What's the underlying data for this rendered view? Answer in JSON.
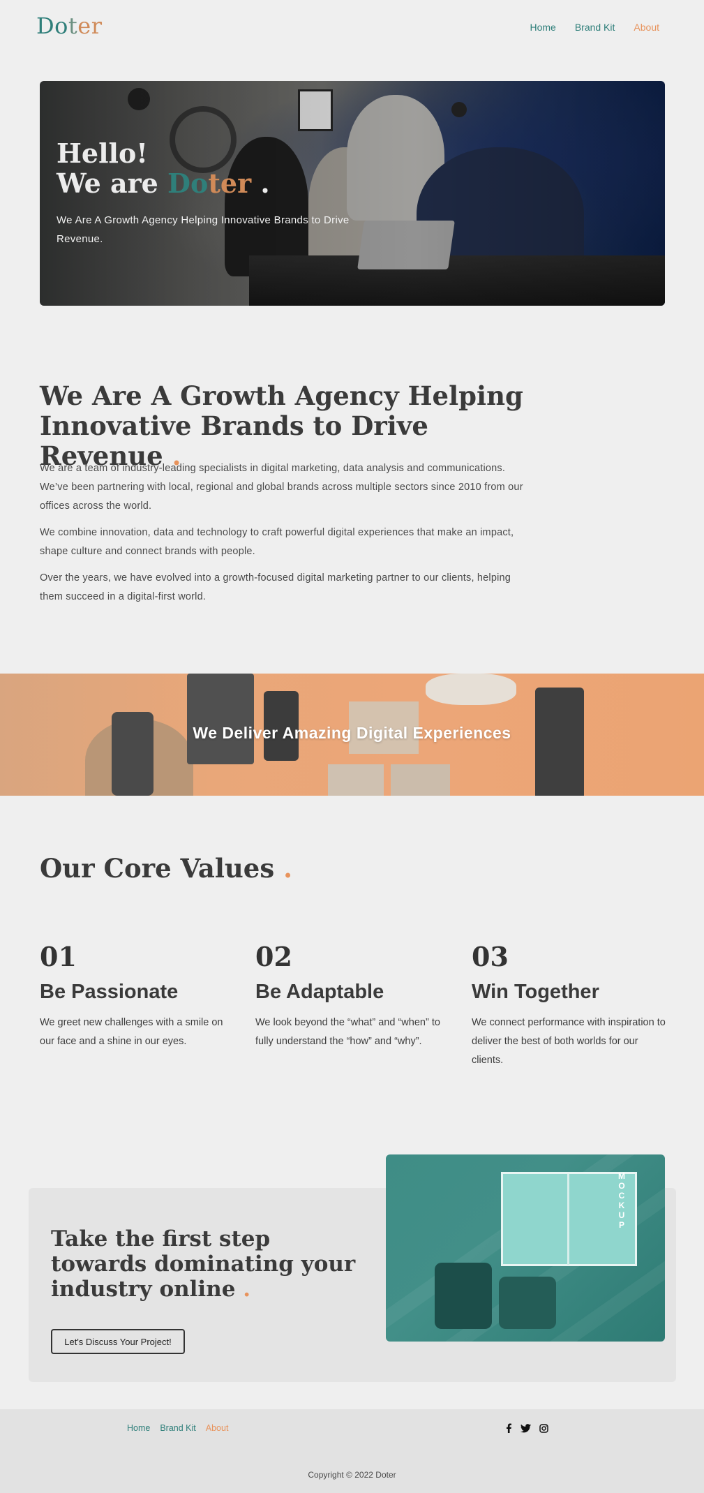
{
  "header": {
    "logo_part1": "Do",
    "logo_part2": "t",
    "logo_part3": "er",
    "nav": [
      {
        "label": "Home"
      },
      {
        "label": "Brand Kit"
      },
      {
        "label": "About"
      }
    ]
  },
  "hero": {
    "line1": "Hello!",
    "line2_prefix": "We are",
    "brand_part1": "Do",
    "brand_part2": "ter",
    "line2_suffix": ".",
    "subtitle": "We Are A Growth Agency Helping Innovative Brands to Drive Revenue."
  },
  "about": {
    "title": "We Are A Growth Agency Helping Innovative Brands to Drive Revenue",
    "title_dot": ".",
    "paragraphs": [
      "We are a team of industry-leading specialists in digital marketing, data analysis and communications. We’ve been partnering with local, regional and global brands across multiple sectors since 2010 from our offices across the world.",
      "We combine innovation, data and technology to craft powerful digital experiences that make an impact, shape culture and connect brands with people.",
      "Over the years, we have evolved into a growth-focused digital marketing partner to our clients, helping them succeed in a digital-first world."
    ]
  },
  "banner": {
    "text": "We Deliver Amazing Digital Experiences"
  },
  "values": {
    "title": "Our Core Values",
    "title_dot": ".",
    "items": [
      {
        "num": "01",
        "name": "Be Passionate",
        "desc": "We greet new challenges with a smile on our face and a shine in our eyes."
      },
      {
        "num": "02",
        "name": "Be Adaptable",
        "desc": "We look beyond the “what” and “when” to fully understand the “how” and “why”."
      },
      {
        "num": "03",
        "name": "Win Together",
        "desc": "We connect performance with inspiration to deliver the best of both worlds for our clients."
      }
    ]
  },
  "cta": {
    "title": "Take the first step towards dominating your industry online",
    "title_dot": ".",
    "button": "Let's Discuss Your Project!",
    "image_text": "MOCKUP"
  },
  "footer": {
    "nav": [
      {
        "label": "Home"
      },
      {
        "label": "Brand Kit"
      },
      {
        "label": "About"
      }
    ],
    "social": [
      "facebook-icon",
      "twitter-icon",
      "instagram-icon"
    ],
    "copyright": "Copyright © 2022 Doter"
  },
  "colors": {
    "teal": "#2f7f7a",
    "orange": "#e8935c",
    "background": "#efefef",
    "text": "#3a3a3a"
  }
}
